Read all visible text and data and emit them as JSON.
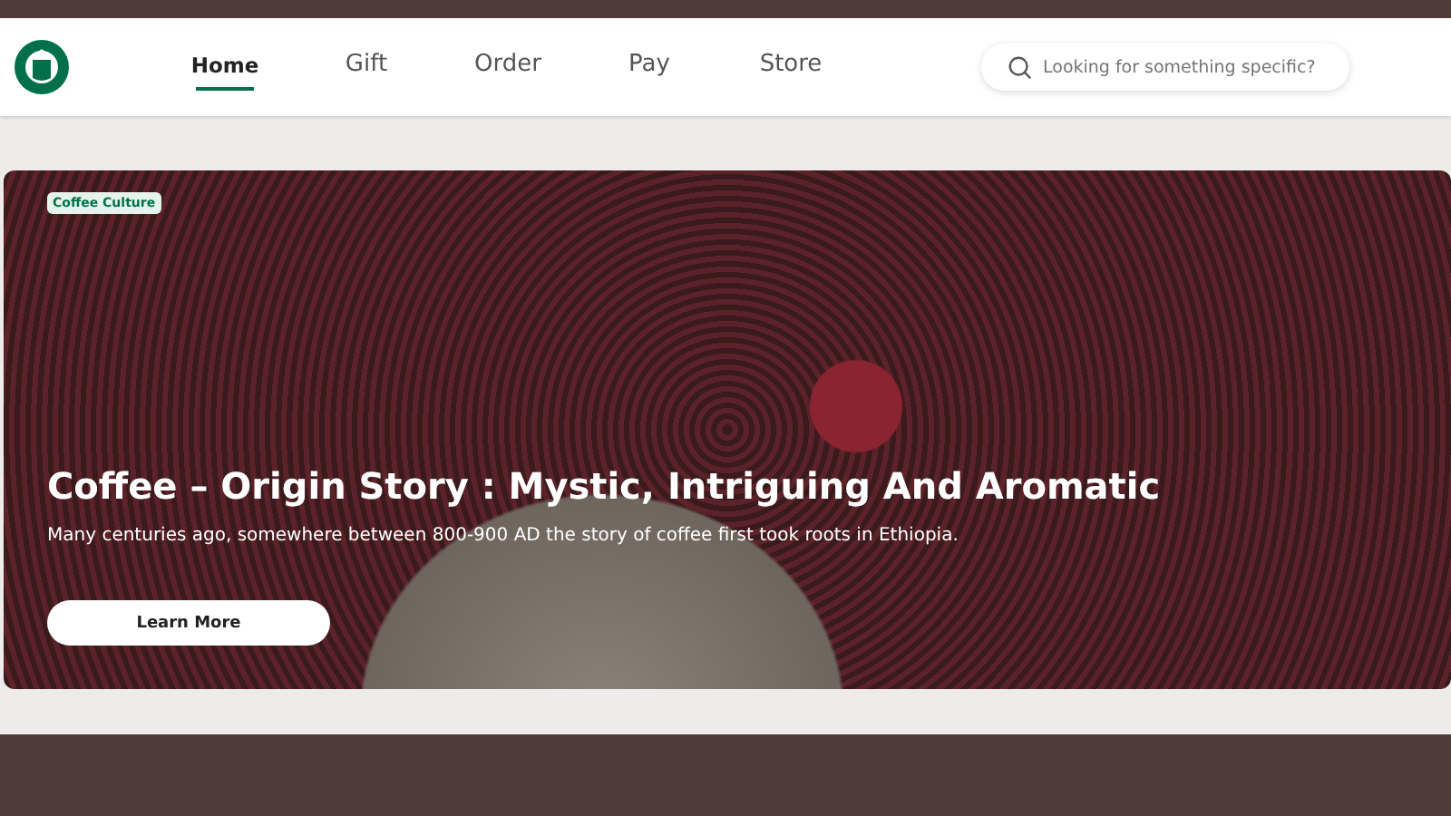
{
  "nav": {
    "tabs": [
      {
        "label": "Home",
        "selected": true
      },
      {
        "label": "Gift",
        "selected": false
      },
      {
        "label": "Order",
        "selected": false
      },
      {
        "label": "Pay",
        "selected": false
      },
      {
        "label": "Store",
        "selected": false
      }
    ]
  },
  "search": {
    "placeholder": "Looking for something specific?"
  },
  "hero": {
    "tag": "Coffee Culture",
    "title": "Coffee – Origin Story : Mystic, Intriguing And Aromatic",
    "text": "Many centuries ago, somewhere between 800-900 AD the story of coffee first took roots in Ethiopia.",
    "button": "Learn More"
  }
}
